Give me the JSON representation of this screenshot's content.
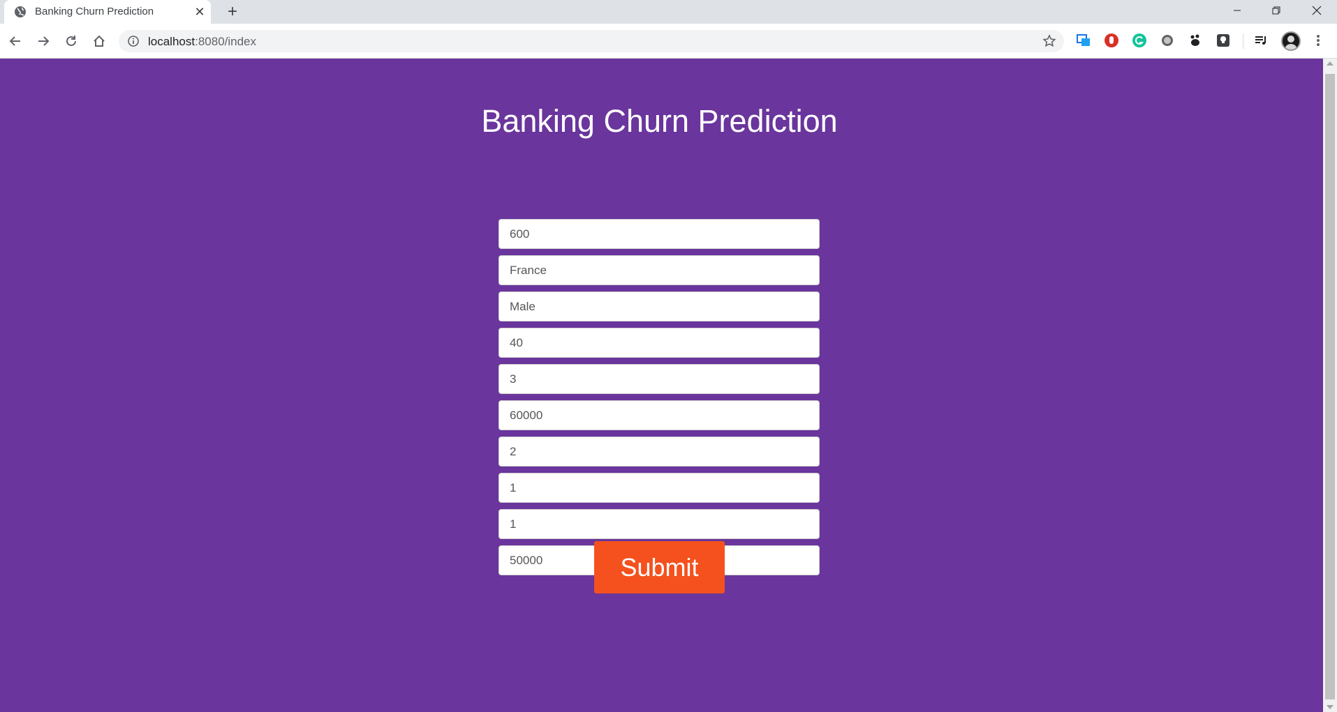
{
  "browser": {
    "tab_title": "Banking Churn Prediction",
    "url_host": "localhost",
    "url_path": ":8080/index"
  },
  "page": {
    "title": "Banking Churn Prediction",
    "fields": [
      "600",
      "France",
      "Male",
      "40",
      "3",
      "60000",
      "2",
      "1",
      "1",
      "50000"
    ],
    "submit_label": "Submit"
  },
  "colors": {
    "page_background": "#6a359c",
    "submit_button": "#f4511e",
    "title_text": "#ffffff"
  }
}
